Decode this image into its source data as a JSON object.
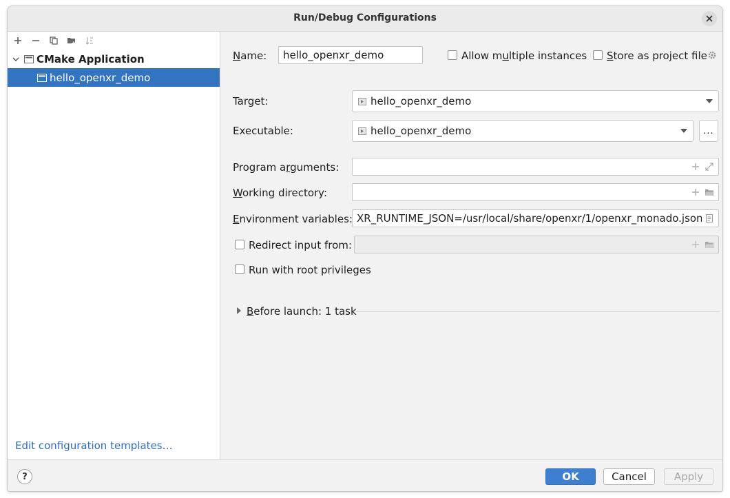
{
  "window": {
    "title": "Run/Debug Configurations"
  },
  "sidebar": {
    "toolbar": [
      "add-icon",
      "remove-icon",
      "copy-icon",
      "new-folder-icon",
      "sort-icon"
    ],
    "root": {
      "label": "CMake Application",
      "expanded": true
    },
    "items": [
      {
        "label": "hello_openxr_demo",
        "selected": true
      }
    ],
    "edit_templates": "Edit configuration templates…"
  },
  "form": {
    "name_label": "Name:",
    "name_value": "hello_openxr_demo",
    "allow_multiple_label": "Allow multiple instances",
    "allow_multiple_checked": false,
    "store_project_label": "Store as project file",
    "store_project_checked": false,
    "target_label": "Target:",
    "target_value": "hello_openxr_demo",
    "executable_label": "Executable:",
    "executable_value": "hello_openxr_demo",
    "browse_label": "...",
    "program_args_label": "Program arguments:",
    "program_args_value": "",
    "working_dir_label": "Working directory:",
    "working_dir_value": "",
    "env_vars_label": "Environment variables:",
    "env_vars_value": "XR_RUNTIME_JSON=/usr/local/share/openxr/1/openxr_monado.json",
    "redirect_label": "Redirect input from:",
    "redirect_checked": false,
    "redirect_value": "",
    "root_priv_label": "Run with root privileges",
    "root_priv_checked": false,
    "before_launch_label": "Before launch: 1 task"
  },
  "footer": {
    "help": "?",
    "ok": "OK",
    "cancel": "Cancel",
    "apply": "Apply"
  },
  "colors": {
    "selection": "#3374c1",
    "link": "#2f6dbd",
    "ok_button": "#3f7fcf"
  }
}
